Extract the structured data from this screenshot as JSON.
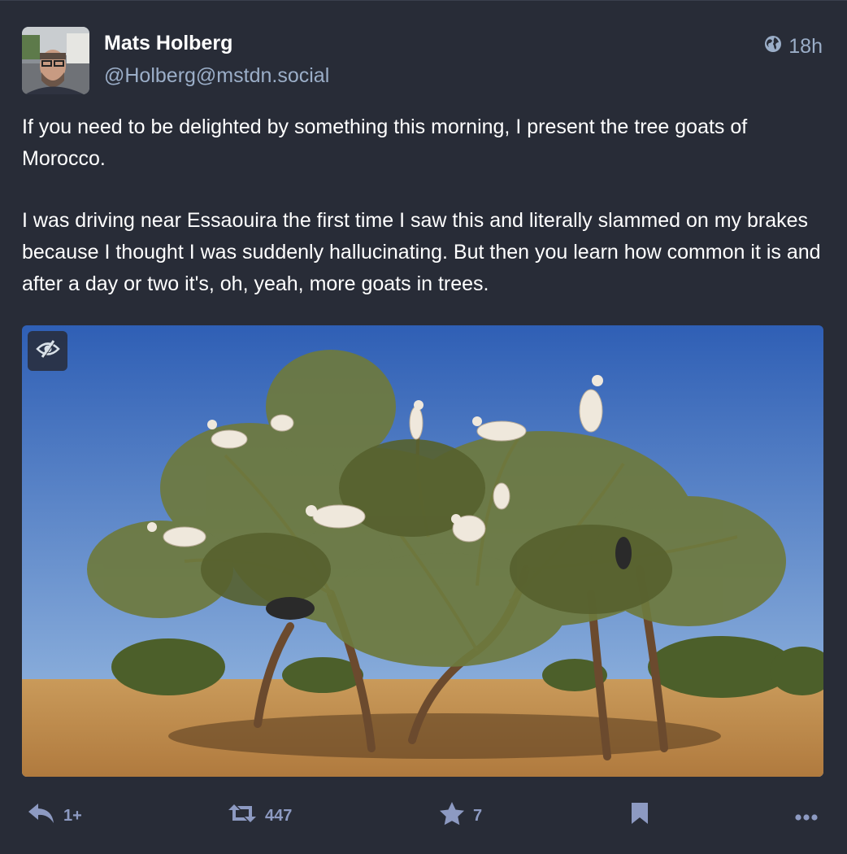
{
  "author": {
    "display_name": "Mats Holberg",
    "acct": "@Holberg@mstdn.social"
  },
  "timestamp": "18h",
  "visibility_icon": "globe-icon",
  "content": {
    "paragraph_1": "If you need to be delighted by something this morning, I present the tree goats of Morocco.",
    "paragraph_2": "I was driving near Essaouira the first time I saw this and literally slammed on my brakes because I thought I was suddenly hallucinating. But then you learn how common it is and after a day or two it's, oh, yeah, more goats in trees."
  },
  "media": {
    "hide_icon": "eye-slash-icon"
  },
  "actions": {
    "reply_count": "1+",
    "boost_count": "447",
    "favourite_count": "7"
  },
  "colors": {
    "background": "#282c37",
    "secondary_text": "#9baec8",
    "action_icon": "#8d9ac2"
  }
}
